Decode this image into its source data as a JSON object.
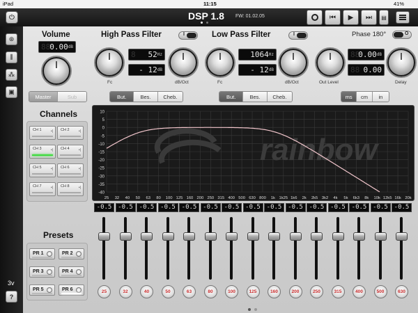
{
  "status": {
    "device": "iPad",
    "time": "11:15",
    "battery": "41%"
  },
  "header": {
    "title": "DSP 1.8",
    "firmware": "FW: 01.02.05"
  },
  "volume": {
    "title": "Volume",
    "value": "0.00",
    "unit": "dB",
    "master_label": "Master",
    "sub_label": "Sub"
  },
  "hpf": {
    "title": "High Pass Filter",
    "freq": "52",
    "freq_unit": "Hz",
    "slope": "- 12",
    "slope_unit": "dB",
    "fc_label": "Fc",
    "slope_label": "dB/Oct",
    "types": [
      "But.",
      "Bes.",
      "Cheb."
    ]
  },
  "lpf": {
    "title": "Low Pass Filter",
    "freq": "1064",
    "freq_unit": "Hz",
    "slope": "- 12",
    "slope_unit": "dB",
    "fc_label": "Fc",
    "slope_label": "dB/Oct",
    "types": [
      "But.",
      "Bes.",
      "Cheb."
    ]
  },
  "phase": {
    "label": "Phase 180°",
    "out_level": "0.00",
    "out_level_unit": "dB",
    "delay": "0.00",
    "out_level_label": "Out Level",
    "delay_label": "Delay",
    "units": [
      "ms",
      "cm",
      "in"
    ]
  },
  "toggles": {
    "on": "I",
    "off": "O"
  },
  "channels": {
    "title": "Channels",
    "items": [
      "CH 1",
      "CH 2",
      "CH 3",
      "CH 4",
      "CH 5",
      "CH 6",
      "CH 7",
      "CH 8"
    ]
  },
  "presets": {
    "title": "Presets",
    "items": [
      "PR 1",
      "PR 2",
      "PR 3",
      "PR 4",
      "PR 5",
      "PR 6"
    ]
  },
  "sidebar": {
    "voltage": "3v",
    "help": "?"
  },
  "graph": {
    "watermark": "rainbow",
    "y_ticks": [
      "10",
      "5",
      "0",
      "-5",
      "-10",
      "-15",
      "-20",
      "-25",
      "-30",
      "-35",
      "-40"
    ],
    "x_ticks": [
      "25",
      "32",
      "40",
      "50",
      "63",
      "80",
      "100",
      "125",
      "160",
      "200",
      "250",
      "315",
      "400",
      "500",
      "630",
      "800",
      "1k",
      "1k25",
      "1k6",
      "2k",
      "2k5",
      "3k2",
      "4k",
      "5k",
      "6k3",
      "8k",
      "10k",
      "12k5",
      "16k",
      "20k"
    ]
  },
  "eq": {
    "gains": [
      "-0.5",
      "-0.5",
      "-0.5",
      "-0.5",
      "-0.5",
      "-0.5",
      "-0.5",
      "-0.5",
      "-0.5",
      "-0.5",
      "-0.5",
      "-0.5",
      "-0.5",
      "-0.5",
      "-0.5"
    ],
    "freqs": [
      "25",
      "32",
      "40",
      "50",
      "63",
      "80",
      "100",
      "125",
      "160",
      "200",
      "250",
      "315",
      "400",
      "500",
      "630"
    ]
  },
  "colors": {
    "curve": "#f2c6cc",
    "accent": "#3ddc3d",
    "freq_text": "#c92a2a"
  }
}
